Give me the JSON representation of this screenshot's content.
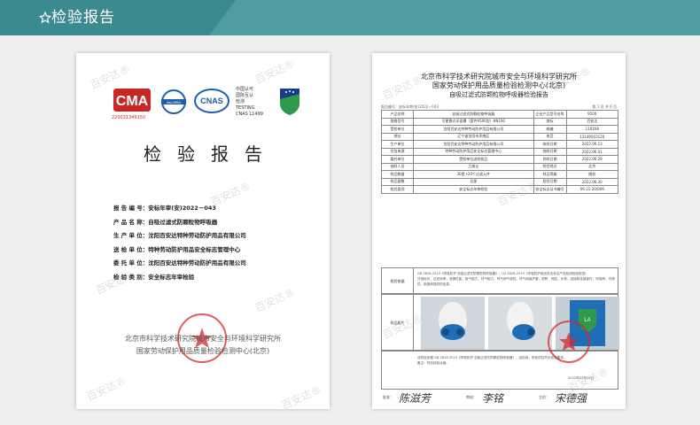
{
  "header": {
    "title": "检验报告",
    "icon": "star-outline-icon",
    "bg_color": "#3b8a8f"
  },
  "watermark": "百安达®",
  "left_doc": {
    "logos": {
      "ma_number": "220031349150",
      "cnas_text": "中国认可\n国际互认\n检测\nTESTING\nCNAS L1499"
    },
    "title": "检验报告",
    "fields": [
      {
        "label": "报 告 编 号：",
        "value": "安标年审(安)2022－043"
      },
      {
        "label": "产 品 名 称：",
        "value": "自吸过滤式防颗粒物呼吸器"
      },
      {
        "label": "生 产 单 位：",
        "value": "沈阳百安达特种劳动防护用品有限公司"
      },
      {
        "label": "送 检 单 位：",
        "value": "特种劳动防护用品安全标志管理中心"
      },
      {
        "label": "委 托 单 位：",
        "value": "沈阳百安达特种劳动防护用品有限公司"
      },
      {
        "label": "检 验 类 别：",
        "value": "安全标志年审检验"
      }
    ],
    "footer_line1": "北京市科学技术研究院城市安全与环境科学研究所",
    "footer_line2": "国家劳动保护用品质量检验检测中心(北京)"
  },
  "right_doc": {
    "header_line1": "北京市科学技术研究院城市安全与环境科学研究所",
    "header_line2": "国家劳动保护用品质量检验检测中心(北京)",
    "header_line3": "自吸过滤式防颗粒物呼吸器检验报告",
    "report_no": "报告编号：安标年审(安)2022－043",
    "page": "第 1 页 共 6 页",
    "rows": [
      [
        "产品名称",
        "自吸过滤式防颗粒物呼吸器",
        "企业产品型号名称",
        "9500"
      ],
      [
        "规格型号",
        "可更换式半面罩（套件9500型）KN100",
        "商标",
        "百安达"
      ],
      [
        "受检单位",
        "沈阳百安达特种劳动防护用品有限公司",
        "邮编",
        "110168"
      ],
      [
        "地址",
        "辽宁省沈阳市浑南区",
        "电话",
        "13149503120"
      ],
      [
        "生产单位",
        "沈阳百安达特种劳动防护用品有限公司",
        "收样日期",
        "2022.06.13"
      ],
      [
        "任务来源",
        "特种劳动防护用品安全标志管理中心",
        "抽样日期",
        "2022.06.01"
      ],
      [
        "委托单位",
        "受检单位送检样品",
        "到样日期",
        "2022.06.29"
      ],
      [
        "抽样人员",
        "王威吉",
        "检验地点",
        "北京"
      ],
      [
        "样品数量",
        "30套+20个过滤元件",
        "样品等级",
        "随机"
      ],
      [
        "样品基数",
        "总部",
        "检验日期",
        "2022.06.30"
      ],
      [
        "检验类别",
        "安全标志年审检验",
        "安全标志证书编号",
        "06-21-20/069"
      ]
    ],
    "basis_label": "检验依据",
    "basis_text": "GB 2626-2019《呼吸防护 自吸过滤式防颗粒物呼吸器》；LD 2626-2019（呼吸防护用品安全标志产品检测检验规范）\n外观标识，过滤效率，泄漏性能，吸气阻力，呼气阻力，呼气阀气密性，呼气阀保护罩，视野，死腔，头带，连接和连接部件，呼吸阀，可燃性，制造商提供的信息。",
    "photos_label": "样品照片",
    "conclusion_text": "该样品依据 GB 2626-2019《呼吸防护 自吸过滤式防颗粒物呼吸器》，经检验，所检项目符合标准要求。\n备注：样品检验合格。",
    "conclusion_date": "2022年07月29日",
    "signers": [
      {
        "label": "批准：",
        "name": "陈滋芳"
      },
      {
        "label": "审核：",
        "name": "李铭"
      },
      {
        "label": "主检：",
        "name": "宋德强"
      }
    ]
  }
}
